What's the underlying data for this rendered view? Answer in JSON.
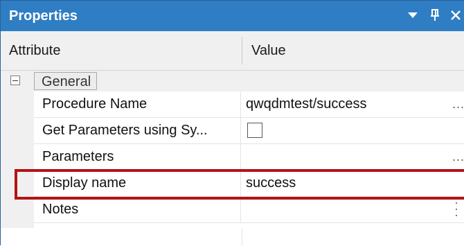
{
  "panel": {
    "title": "Properties",
    "colors": {
      "titlebar": "#2f7ec3",
      "highlight": "#b31217"
    },
    "buttons": {
      "dropdown_icon": "chevron-down-icon",
      "pin_icon": "pin-icon",
      "close_icon": "close-icon"
    }
  },
  "columns": {
    "attribute": "Attribute",
    "value": "Value"
  },
  "category": {
    "label": "General",
    "expander_icon": "collapse-minus-icon"
  },
  "rows": [
    {
      "name": "Procedure Name",
      "value": "qwqdmtest/success",
      "ellipsis": "..."
    },
    {
      "name": "Get Parameters using Sy...",
      "checked": false
    },
    {
      "name": "Parameters",
      "value": "",
      "ellipsis": "..."
    },
    {
      "name": "Display name",
      "value": "success",
      "highlighted": true
    },
    {
      "name": "Notes",
      "value": ""
    }
  ]
}
